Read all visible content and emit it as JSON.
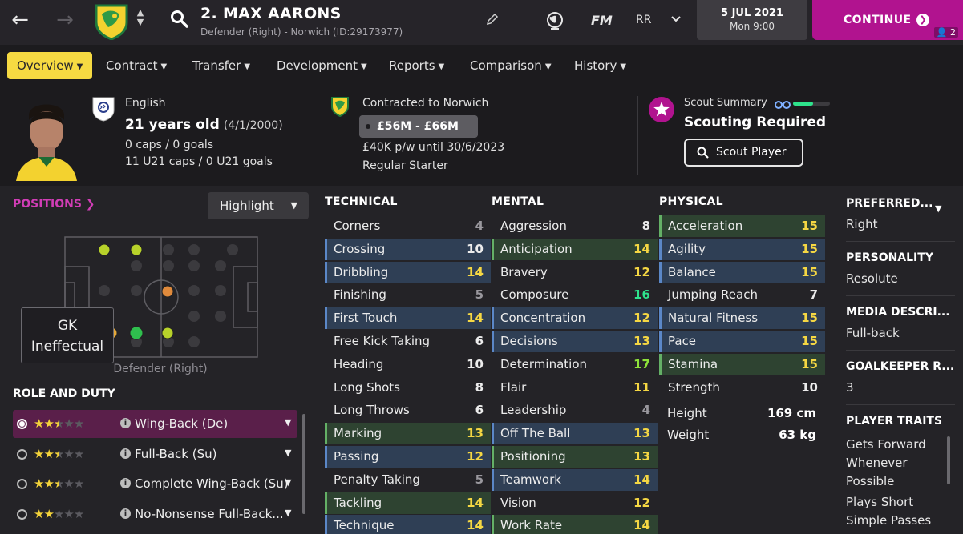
{
  "topbar": {
    "title": "2. MAX AARONS",
    "subtitle": "Defender (Right) - Norwich (ID:29173977)",
    "fm_label": "FM",
    "user_initials": "RR",
    "date": "5 JUL 2021",
    "time": "Mon 9:00",
    "continue_label": "CONTINUE",
    "continue_badge": "2"
  },
  "tabs": [
    {
      "label": "Overview",
      "active": true
    },
    {
      "label": "Contract"
    },
    {
      "label": "Transfer"
    },
    {
      "label": "Development"
    },
    {
      "label": "Reports"
    },
    {
      "label": "Comparison"
    },
    {
      "label": "History"
    }
  ],
  "header": {
    "nationality": "English",
    "age": "21 years old",
    "dob": "(4/1/2000)",
    "caps": "0 caps / 0 goals",
    "u21_caps": "11 U21 caps / 0 U21 goals",
    "contracted_to": "Contracted to Norwich",
    "value_range": "£56M - £66M",
    "wage": "£40K p/w until 30/6/2023",
    "squad_status": "Regular Starter",
    "scout_summary_label": "Scout Summary",
    "scout_status": "Scouting Required",
    "scout_button": "Scout Player",
    "scout_knowledge": 0.55
  },
  "positions": {
    "link_label": "POSITIONS",
    "highlight_label": "Highlight",
    "tooltip_line1": "GK",
    "tooltip_line2": "Ineffectual",
    "position_label": "Defender (Right)"
  },
  "roles": {
    "heading": "ROLE AND DUTY",
    "items": [
      {
        "name": "Wing-Back (De)",
        "stars": 2.5,
        "selected": true
      },
      {
        "name": "Full-Back (Su)",
        "stars": 2.5
      },
      {
        "name": "Complete Wing-Back (Su)",
        "stars": 2.5
      },
      {
        "name": "No-Nonsense Full-Back...",
        "stars": 2
      }
    ]
  },
  "attributes": {
    "technical": {
      "heading": "TECHNICAL",
      "items": [
        {
          "name": "Corners",
          "value": 4
        },
        {
          "name": "Crossing",
          "value": 10,
          "hl": "h1"
        },
        {
          "name": "Dribbling",
          "value": 14,
          "hl": "h1"
        },
        {
          "name": "Finishing",
          "value": 5
        },
        {
          "name": "First Touch",
          "value": 14,
          "hl": "h1"
        },
        {
          "name": "Free Kick Taking",
          "value": 6
        },
        {
          "name": "Heading",
          "value": 10
        },
        {
          "name": "Long Shots",
          "value": 8
        },
        {
          "name": "Long Throws",
          "value": 6
        },
        {
          "name": "Marking",
          "value": 13,
          "hl": "h2"
        },
        {
          "name": "Passing",
          "value": 12,
          "hl": "h1"
        },
        {
          "name": "Penalty Taking",
          "value": 5
        },
        {
          "name": "Tackling",
          "value": 14,
          "hl": "h2"
        },
        {
          "name": "Technique",
          "value": 14,
          "hl": "h1"
        }
      ]
    },
    "mental": {
      "heading": "MENTAL",
      "items": [
        {
          "name": "Aggression",
          "value": 8
        },
        {
          "name": "Anticipation",
          "value": 14,
          "hl": "h2"
        },
        {
          "name": "Bravery",
          "value": 12
        },
        {
          "name": "Composure",
          "value": 16
        },
        {
          "name": "Concentration",
          "value": 12,
          "hl": "h1"
        },
        {
          "name": "Decisions",
          "value": 13,
          "hl": "h1"
        },
        {
          "name": "Determination",
          "value": 17
        },
        {
          "name": "Flair",
          "value": 11
        },
        {
          "name": "Leadership",
          "value": 4
        },
        {
          "name": "Off The Ball",
          "value": 13,
          "hl": "h1"
        },
        {
          "name": "Positioning",
          "value": 13,
          "hl": "h2"
        },
        {
          "name": "Teamwork",
          "value": 14,
          "hl": "h1"
        },
        {
          "name": "Vision",
          "value": 12
        },
        {
          "name": "Work Rate",
          "value": 14,
          "hl": "h2"
        }
      ]
    },
    "physical": {
      "heading": "PHYSICAL",
      "items": [
        {
          "name": "Acceleration",
          "value": 15,
          "hl": "h2"
        },
        {
          "name": "Agility",
          "value": 15,
          "hl": "h1"
        },
        {
          "name": "Balance",
          "value": 15,
          "hl": "h1"
        },
        {
          "name": "Jumping Reach",
          "value": 7
        },
        {
          "name": "Natural Fitness",
          "value": 15,
          "hl": "h1"
        },
        {
          "name": "Pace",
          "value": 15,
          "hl": "h1"
        },
        {
          "name": "Stamina",
          "value": 15,
          "hl": "h2"
        },
        {
          "name": "Strength",
          "value": 10
        }
      ],
      "height_label": "Height",
      "height_value": "169 cm",
      "weight_label": "Weight",
      "weight_value": "63 kg"
    }
  },
  "side": {
    "preferred_foot_label": "PREFERRED...",
    "preferred_foot_value": "Right",
    "personality_label": "PERSONALITY",
    "personality_value": "Resolute",
    "media_label": "MEDIA DESCRI...",
    "media_value": "Full-back",
    "gk_rating_label": "GOALKEEPER R...",
    "gk_rating_value": "3",
    "traits_label": "PLAYER TRAITS",
    "traits": [
      "Gets Forward Whenever Possible",
      "Plays Short Simple Passes"
    ]
  },
  "colors": {
    "accent_magenta": "#b1138f",
    "tab_active": "#f6da42",
    "highlight_blue": "#2f3f55",
    "highlight_green": "#2e4331"
  }
}
